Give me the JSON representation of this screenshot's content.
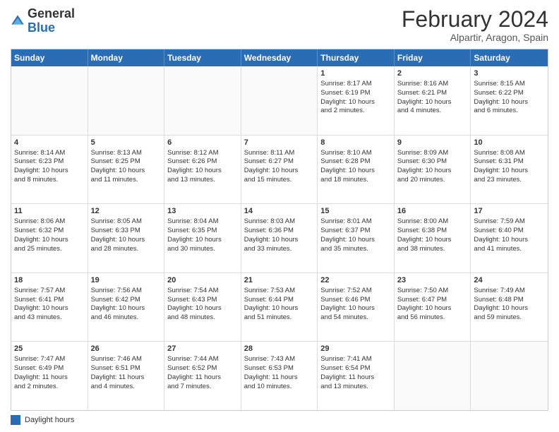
{
  "header": {
    "logo_general": "General",
    "logo_blue": "Blue",
    "main_title": "February 2024",
    "sub_title": "Alpartir, Aragon, Spain"
  },
  "calendar": {
    "days_of_week": [
      "Sunday",
      "Monday",
      "Tuesday",
      "Wednesday",
      "Thursday",
      "Friday",
      "Saturday"
    ],
    "weeks": [
      [
        {
          "day": "",
          "info": ""
        },
        {
          "day": "",
          "info": ""
        },
        {
          "day": "",
          "info": ""
        },
        {
          "day": "",
          "info": ""
        },
        {
          "day": "1",
          "info": "Sunrise: 8:17 AM\nSunset: 6:19 PM\nDaylight: 10 hours\nand 2 minutes."
        },
        {
          "day": "2",
          "info": "Sunrise: 8:16 AM\nSunset: 6:21 PM\nDaylight: 10 hours\nand 4 minutes."
        },
        {
          "day": "3",
          "info": "Sunrise: 8:15 AM\nSunset: 6:22 PM\nDaylight: 10 hours\nand 6 minutes."
        }
      ],
      [
        {
          "day": "4",
          "info": "Sunrise: 8:14 AM\nSunset: 6:23 PM\nDaylight: 10 hours\nand 8 minutes."
        },
        {
          "day": "5",
          "info": "Sunrise: 8:13 AM\nSunset: 6:25 PM\nDaylight: 10 hours\nand 11 minutes."
        },
        {
          "day": "6",
          "info": "Sunrise: 8:12 AM\nSunset: 6:26 PM\nDaylight: 10 hours\nand 13 minutes."
        },
        {
          "day": "7",
          "info": "Sunrise: 8:11 AM\nSunset: 6:27 PM\nDaylight: 10 hours\nand 15 minutes."
        },
        {
          "day": "8",
          "info": "Sunrise: 8:10 AM\nSunset: 6:28 PM\nDaylight: 10 hours\nand 18 minutes."
        },
        {
          "day": "9",
          "info": "Sunrise: 8:09 AM\nSunset: 6:30 PM\nDaylight: 10 hours\nand 20 minutes."
        },
        {
          "day": "10",
          "info": "Sunrise: 8:08 AM\nSunset: 6:31 PM\nDaylight: 10 hours\nand 23 minutes."
        }
      ],
      [
        {
          "day": "11",
          "info": "Sunrise: 8:06 AM\nSunset: 6:32 PM\nDaylight: 10 hours\nand 25 minutes."
        },
        {
          "day": "12",
          "info": "Sunrise: 8:05 AM\nSunset: 6:33 PM\nDaylight: 10 hours\nand 28 minutes."
        },
        {
          "day": "13",
          "info": "Sunrise: 8:04 AM\nSunset: 6:35 PM\nDaylight: 10 hours\nand 30 minutes."
        },
        {
          "day": "14",
          "info": "Sunrise: 8:03 AM\nSunset: 6:36 PM\nDaylight: 10 hours\nand 33 minutes."
        },
        {
          "day": "15",
          "info": "Sunrise: 8:01 AM\nSunset: 6:37 PM\nDaylight: 10 hours\nand 35 minutes."
        },
        {
          "day": "16",
          "info": "Sunrise: 8:00 AM\nSunset: 6:38 PM\nDaylight: 10 hours\nand 38 minutes."
        },
        {
          "day": "17",
          "info": "Sunrise: 7:59 AM\nSunset: 6:40 PM\nDaylight: 10 hours\nand 41 minutes."
        }
      ],
      [
        {
          "day": "18",
          "info": "Sunrise: 7:57 AM\nSunset: 6:41 PM\nDaylight: 10 hours\nand 43 minutes."
        },
        {
          "day": "19",
          "info": "Sunrise: 7:56 AM\nSunset: 6:42 PM\nDaylight: 10 hours\nand 46 minutes."
        },
        {
          "day": "20",
          "info": "Sunrise: 7:54 AM\nSunset: 6:43 PM\nDaylight: 10 hours\nand 48 minutes."
        },
        {
          "day": "21",
          "info": "Sunrise: 7:53 AM\nSunset: 6:44 PM\nDaylight: 10 hours\nand 51 minutes."
        },
        {
          "day": "22",
          "info": "Sunrise: 7:52 AM\nSunset: 6:46 PM\nDaylight: 10 hours\nand 54 minutes."
        },
        {
          "day": "23",
          "info": "Sunrise: 7:50 AM\nSunset: 6:47 PM\nDaylight: 10 hours\nand 56 minutes."
        },
        {
          "day": "24",
          "info": "Sunrise: 7:49 AM\nSunset: 6:48 PM\nDaylight: 10 hours\nand 59 minutes."
        }
      ],
      [
        {
          "day": "25",
          "info": "Sunrise: 7:47 AM\nSunset: 6:49 PM\nDaylight: 11 hours\nand 2 minutes."
        },
        {
          "day": "26",
          "info": "Sunrise: 7:46 AM\nSunset: 6:51 PM\nDaylight: 11 hours\nand 4 minutes."
        },
        {
          "day": "27",
          "info": "Sunrise: 7:44 AM\nSunset: 6:52 PM\nDaylight: 11 hours\nand 7 minutes."
        },
        {
          "day": "28",
          "info": "Sunrise: 7:43 AM\nSunset: 6:53 PM\nDaylight: 11 hours\nand 10 minutes."
        },
        {
          "day": "29",
          "info": "Sunrise: 7:41 AM\nSunset: 6:54 PM\nDaylight: 11 hours\nand 13 minutes."
        },
        {
          "day": "",
          "info": ""
        },
        {
          "day": "",
          "info": ""
        }
      ]
    ]
  },
  "footer": {
    "legend_label": "Daylight hours"
  }
}
